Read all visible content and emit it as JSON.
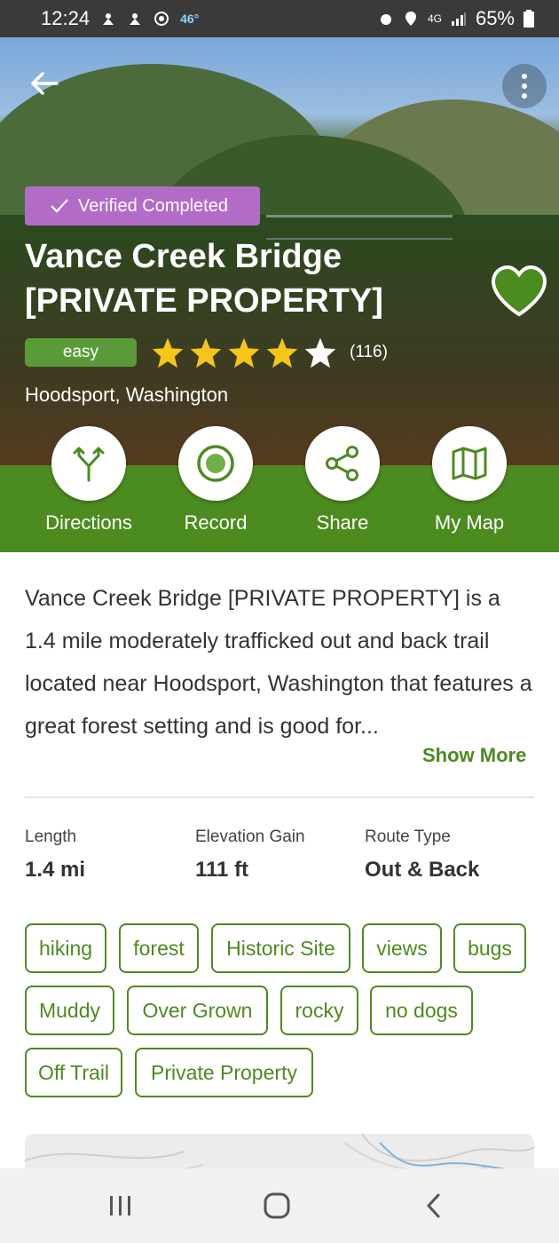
{
  "status_bar": {
    "time": "12:24",
    "temperature": "46°",
    "network": "4G",
    "battery": "65%"
  },
  "hero": {
    "verified_label": "Verified Completed",
    "title": "Vance Creek Bridge [PRIVATE PROPERTY]",
    "difficulty": "easy",
    "rating": 4,
    "rating_max": 5,
    "review_count": "(116)",
    "location": "Hoodsport, Washington",
    "favorited": true
  },
  "actions": [
    {
      "label": "Directions",
      "icon": "directions-icon"
    },
    {
      "label": "Record",
      "icon": "record-icon"
    },
    {
      "label": "Share",
      "icon": "share-icon"
    },
    {
      "label": "My Map",
      "icon": "map-icon"
    }
  ],
  "description": {
    "text": "Vance Creek Bridge [PRIVATE PROPERTY] is a 1.4 mile moderately trafficked out and back trail located near Hoodsport, Washington that features a great forest setting and is good for...",
    "show_more": "Show More"
  },
  "stats": [
    {
      "label": "Length",
      "value": "1.4 mi"
    },
    {
      "label": "Elevation Gain",
      "value": "111 ft"
    },
    {
      "label": "Route Type",
      "value": "Out & Back"
    }
  ],
  "tags": [
    "hiking",
    "forest",
    "Historic Site",
    "views",
    "bugs",
    "Muddy",
    "Over Grown",
    "rocky",
    "no dogs",
    "Off Trail",
    "Private Property"
  ],
  "colors": {
    "brand_green": "#4c8b1f",
    "difficulty_green": "#5b9a38",
    "verified_purple": "#b36bc8",
    "star_yellow": "#f5c518"
  }
}
